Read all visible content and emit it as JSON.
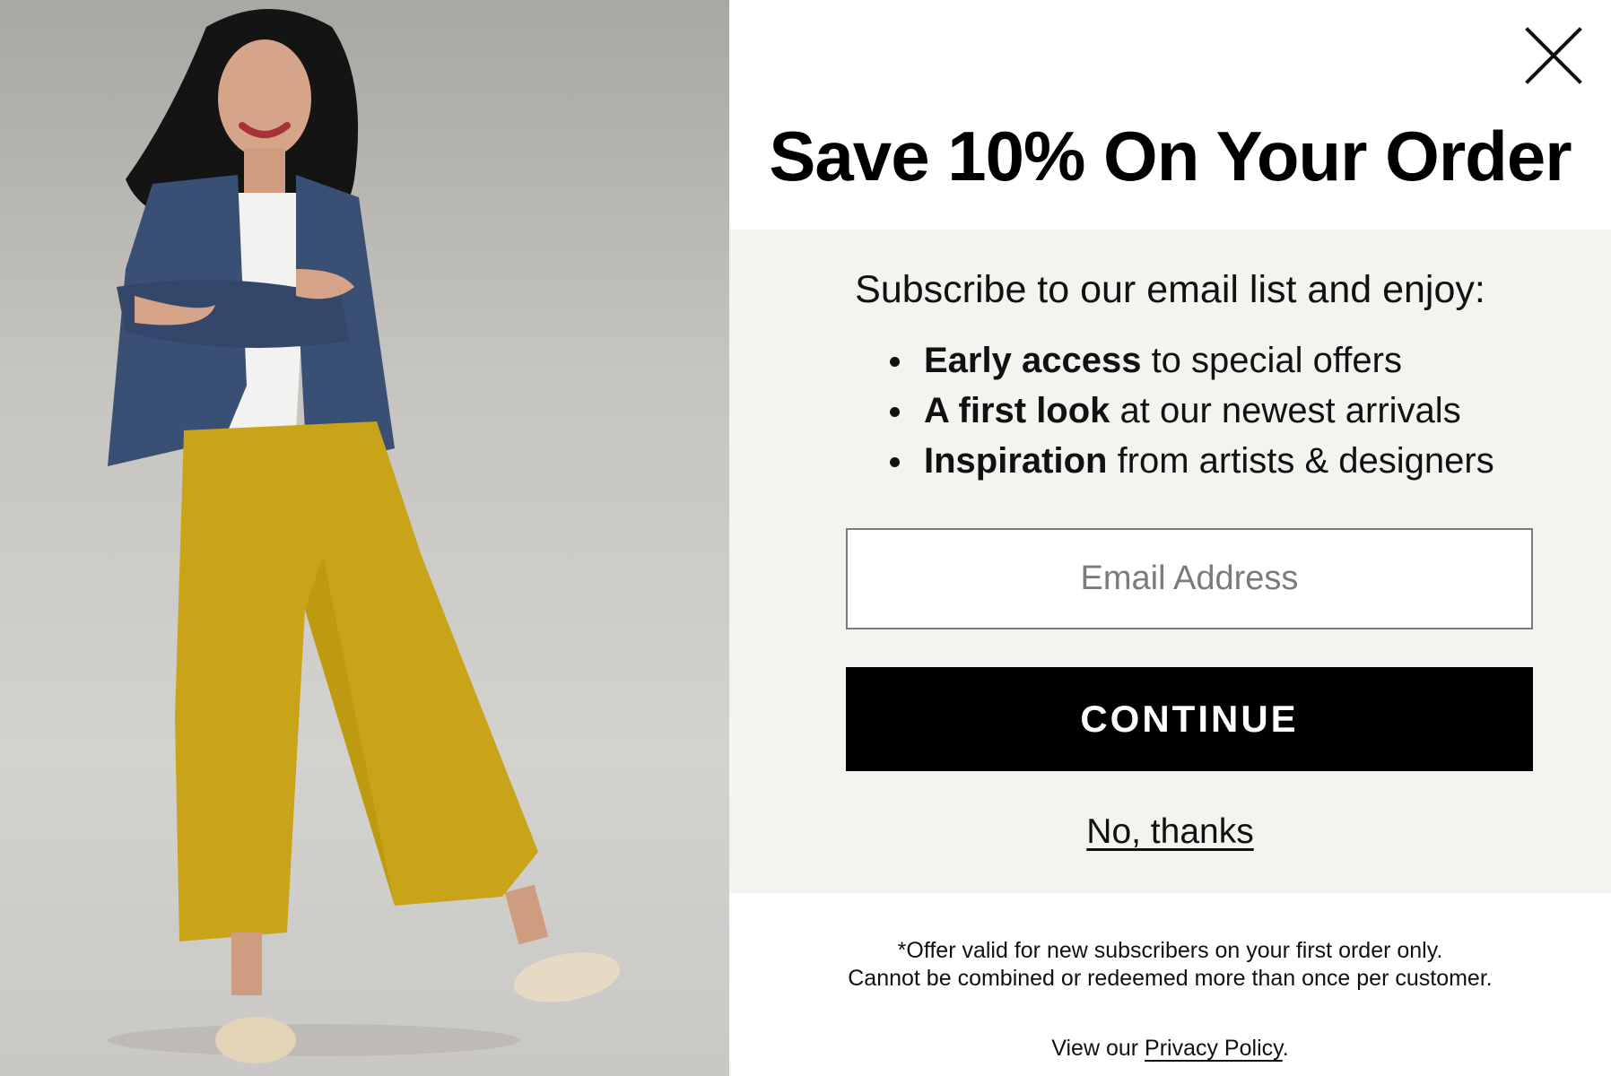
{
  "popup": {
    "close_icon": "close-icon",
    "headline": "Save 10% On Your Order",
    "intro": "Subscribe to our email list and enjoy:",
    "benefits": [
      {
        "bold": "Early access",
        "rest": " to special offers"
      },
      {
        "bold": "A first look",
        "rest": " at our newest arrivals"
      },
      {
        "bold": "Inspiration",
        "rest": " from artists & designers"
      }
    ],
    "email": {
      "placeholder": "Email Address",
      "value": ""
    },
    "continue_label": "CONTINUE",
    "decline_label": "No, thanks",
    "disclaimer_line1": "*Offer valid for new subscribers on your first order only.",
    "disclaimer_line2": "Cannot be combined or redeemed more than once per customer.",
    "privacy_prefix": "View our ",
    "privacy_link": "Privacy Policy",
    "privacy_suffix": "."
  },
  "colors": {
    "button_bg": "#000000",
    "body_box_bg": "#f4f3f0",
    "pants": "#c9a419",
    "jacket": "#3a4f74"
  }
}
